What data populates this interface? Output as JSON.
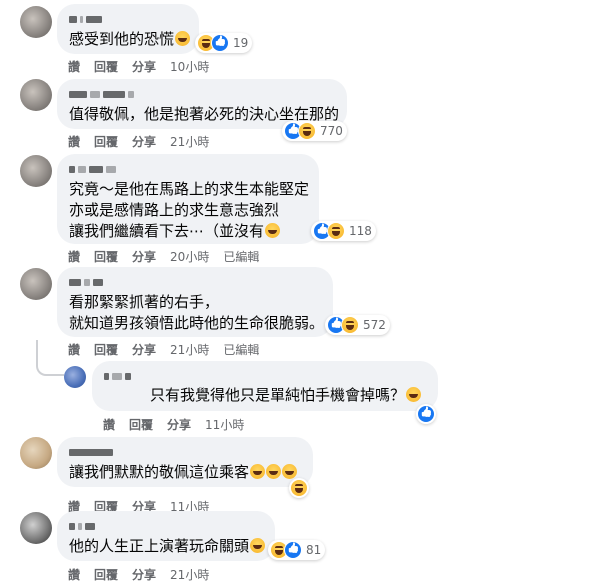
{
  "comments": [
    {
      "text": "感受到他的恐慌",
      "inline_emoji": "haha-emoji",
      "reactions": {
        "icons": [
          "haha",
          "like"
        ],
        "count": "19"
      },
      "actions": {
        "like": "讚",
        "reply": "回覆",
        "share": "分享",
        "time": "10小時",
        "edited": ""
      }
    },
    {
      "text": "值得敬佩，他是抱著必死的決心坐在那的",
      "inline_emoji": "",
      "reactions": {
        "icons": [
          "like",
          "haha"
        ],
        "count": "770"
      },
      "actions": {
        "like": "讚",
        "reply": "回覆",
        "share": "分享",
        "time": "21小時",
        "edited": ""
      }
    },
    {
      "text_lines": [
        "究竟～是他在馬路上的求生本能堅定",
        "亦或是感情路上的求生意志強烈",
        "讓我們繼續看下去⋯（並沒有"
      ],
      "inline_emoji": "haha-emoji",
      "reactions": {
        "icons": [
          "like",
          "haha"
        ],
        "count": "118"
      },
      "actions": {
        "like": "讚",
        "reply": "回覆",
        "share": "分享",
        "time": "20小時",
        "edited": "已編輯"
      }
    },
    {
      "text_lines": [
        "看那緊緊抓著的右手，",
        "就知道男孩領悟此時他的生命很脆弱。"
      ],
      "inline_emoji": "",
      "reactions": {
        "icons": [
          "like",
          "haha"
        ],
        "count": "572"
      },
      "actions": {
        "like": "讚",
        "reply": "回覆",
        "share": "分享",
        "time": "21小時",
        "edited": "已編輯"
      }
    },
    {
      "text": "只有我覺得他只是單純怕手機會掉嗎？",
      "inline_emoji": "haha-emoji",
      "reactions": {
        "icons": [
          "like"
        ],
        "count": ""
      },
      "actions": {
        "like": "讚",
        "reply": "回覆",
        "share": "分享",
        "time": "11小時",
        "edited": ""
      }
    },
    {
      "text": "讓我們默默的敬佩這位乘客",
      "inline_emoji": "haha-emoji x3",
      "reactions": {
        "icons": [
          "haha"
        ],
        "count": ""
      },
      "actions": {
        "like": "讚",
        "reply": "回覆",
        "share": "分享",
        "time": "11小時",
        "edited": ""
      }
    },
    {
      "text": "他的人生正上演著玩命關頭",
      "inline_emoji": "haha-emoji",
      "reactions": {
        "icons": [
          "haha",
          "like"
        ],
        "count": "81"
      },
      "actions": {
        "like": "讚",
        "reply": "回覆",
        "share": "分享",
        "time": "21小時",
        "edited": ""
      }
    }
  ],
  "colors": {
    "bubble": "#f0f2f5",
    "like_blue": "#1877f2",
    "haha_yellow": "#f7b125",
    "meta_gray": "#65676b"
  }
}
